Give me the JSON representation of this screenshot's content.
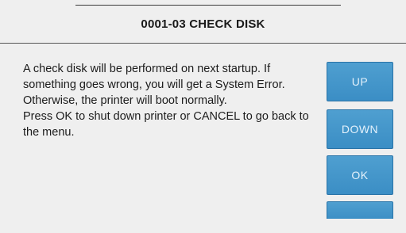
{
  "dialog": {
    "title": "0001-03 CHECK DISK",
    "message_lines": [
      "A check disk will be performed on next startup. If",
      "something goes wrong, you will get a System Error.",
      "Otherwise, the printer will boot normally.",
      "Press OK to shut down printer or CANCEL to go back to",
      "the menu."
    ]
  },
  "buttons": {
    "up": "UP",
    "down": "DOWN",
    "ok": "OK",
    "partial": ""
  },
  "colors": {
    "background": "#efefef",
    "button": "#4096ca",
    "button_text": "#e3f1fb"
  }
}
